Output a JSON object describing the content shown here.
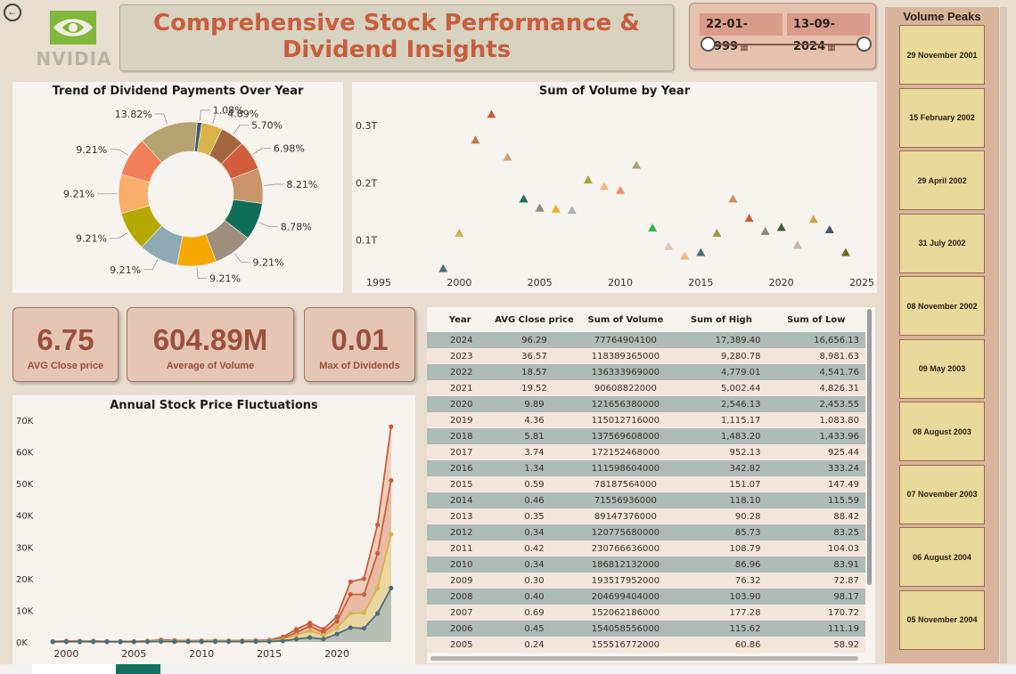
{
  "header": {
    "title_line1": "Comprehensive Stock Performance &",
    "title_line2": "Dividend Insights",
    "logo_text": "NVIDIA",
    "back_icon": "back-arrow-icon"
  },
  "date_filter": {
    "start": "22-01-1999",
    "end": "13-09-2024",
    "start_fraction": 0,
    "end_fraction": 1
  },
  "volume_peaks": {
    "title": "Volume Peaks",
    "items": [
      "29 November 2001",
      "15 February 2002",
      "29 April 2002",
      "31 July 2002",
      "08 November 2002",
      "09 May 2003",
      "08 August 2003",
      "07 November 2003",
      "06 August 2004",
      "05 November 2004"
    ]
  },
  "kpis": {
    "avg_close": {
      "value": "6.75",
      "label": "AVG Close price"
    },
    "avg_volume": {
      "value": "604.89M",
      "label": "Average of Volume"
    },
    "max_dividends": {
      "value": "0.01",
      "label": "Max of Dividends"
    }
  },
  "colors": {
    "accent": "#c95d3d",
    "background": "#e9ddd0",
    "panel": "#f7f3ee",
    "kpi": "#e5c5b4"
  },
  "table": {
    "headers": [
      "Year",
      "AVG Close price",
      "Sum of Volume",
      "Sum of High",
      "Sum of Low"
    ],
    "rows": [
      [
        "2024",
        "96.29",
        "77764904100",
        "17,389.40",
        "16,656.13"
      ],
      [
        "2023",
        "36.57",
        "118389365000",
        "9,280.78",
        "8,981.63"
      ],
      [
        "2022",
        "18.57",
        "136333969000",
        "4,779.01",
        "4,541.76"
      ],
      [
        "2021",
        "19.52",
        "90608822000",
        "5,002.44",
        "4,826.31"
      ],
      [
        "2020",
        "9.89",
        "121656380000",
        "2,546.13",
        "2,453.55"
      ],
      [
        "2019",
        "4.36",
        "115012716000",
        "1,115.17",
        "1,083.80"
      ],
      [
        "2018",
        "5.81",
        "137569608000",
        "1,483.20",
        "1,433.96"
      ],
      [
        "2017",
        "3.74",
        "172152468000",
        "952.13",
        "925.44"
      ],
      [
        "2016",
        "1.34",
        "111598604000",
        "342.82",
        "333.24"
      ],
      [
        "2015",
        "0.59",
        "78187564000",
        "151.07",
        "147.49"
      ],
      [
        "2014",
        "0.46",
        "71556936000",
        "118.10",
        "115.59"
      ],
      [
        "2013",
        "0.35",
        "89147376000",
        "90.28",
        "88.42"
      ],
      [
        "2012",
        "0.34",
        "120775680000",
        "85.73",
        "83.25"
      ],
      [
        "2011",
        "0.42",
        "230766636000",
        "108.79",
        "104.03"
      ],
      [
        "2010",
        "0.34",
        "186812132000",
        "86.96",
        "83.91"
      ],
      [
        "2009",
        "0.30",
        "193517952000",
        "76.32",
        "72.87"
      ],
      [
        "2008",
        "0.40",
        "204699404000",
        "103.90",
        "98.17"
      ],
      [
        "2007",
        "0.69",
        "152062186000",
        "177.28",
        "170.72"
      ],
      [
        "2006",
        "0.45",
        "154058556000",
        "115.62",
        "111.19"
      ],
      [
        "2005",
        "0.24",
        "155516772000",
        "60.86",
        "58.92"
      ]
    ]
  },
  "chart_data": [
    {
      "type": "pie",
      "title": "Trend of Dividend Payments Over Year",
      "donut": true,
      "labels": [
        "1.08%",
        "4.89%",
        "5.70%",
        "6.98%",
        "8.21%",
        "8.78%",
        "9.21%",
        "9.21%",
        "9.21%",
        "9.21%",
        "9.21%",
        "9.21%",
        "13.82%"
      ],
      "values": [
        1.08,
        4.89,
        5.7,
        6.98,
        8.21,
        8.78,
        9.21,
        9.21,
        9.21,
        9.21,
        9.21,
        9.21,
        13.82
      ],
      "colors": [
        "#3e5c76",
        "#d9b34a",
        "#a3663d",
        "#d45e3c",
        "#c9946a",
        "#0f6e58",
        "#9e8e7e",
        "#f5a800",
        "#8daab5",
        "#b5a800",
        "#f9ae6a",
        "#f27f5a",
        "#b7a370"
      ]
    },
    {
      "type": "scatter",
      "title": "Sum of Volume by Year",
      "xlim": [
        1995,
        2025
      ],
      "xticks": [
        "1995",
        "2000",
        "2005",
        "2010",
        "2015",
        "2020",
        "2025"
      ],
      "yticks": [
        {
          "v": 0.1,
          "label": "0.1T"
        },
        {
          "v": 0.2,
          "label": "0.2T"
        },
        {
          "v": 0.3,
          "label": "0.3T"
        }
      ],
      "ylim": [
        0.04,
        0.33
      ],
      "marker": "triangle",
      "points": [
        {
          "x": 1999,
          "y": 0.05,
          "color": "#4a6e7a"
        },
        {
          "x": 2000,
          "y": 0.112,
          "color": "#c8b45a"
        },
        {
          "x": 2001,
          "y": 0.275,
          "color": "#c07a4a"
        },
        {
          "x": 2002,
          "y": 0.32,
          "color": "#c95d3d"
        },
        {
          "x": 2003,
          "y": 0.245,
          "color": "#d4a070"
        },
        {
          "x": 2004,
          "y": 0.172,
          "color": "#1f6e5a"
        },
        {
          "x": 2005,
          "y": 0.156,
          "color": "#8f8680"
        },
        {
          "x": 2006,
          "y": 0.154,
          "color": "#f3b01e"
        },
        {
          "x": 2007,
          "y": 0.152,
          "color": "#9fb3b8"
        },
        {
          "x": 2008,
          "y": 0.205,
          "color": "#a8a23a"
        },
        {
          "x": 2009,
          "y": 0.194,
          "color": "#f3b880"
        },
        {
          "x": 2010,
          "y": 0.187,
          "color": "#ee8a6a"
        },
        {
          "x": 2011,
          "y": 0.231,
          "color": "#a8a07a"
        },
        {
          "x": 2012,
          "y": 0.121,
          "color": "#28b848"
        },
        {
          "x": 2013,
          "y": 0.089,
          "color": "#e0c8b4"
        },
        {
          "x": 2014,
          "y": 0.072,
          "color": "#f3b880"
        },
        {
          "x": 2015,
          "y": 0.078,
          "color": "#4a6e7a"
        },
        {
          "x": 2016,
          "y": 0.112,
          "color": "#9a9a38"
        },
        {
          "x": 2017,
          "y": 0.172,
          "color": "#d48a5a"
        },
        {
          "x": 2018,
          "y": 0.138,
          "color": "#c95d3d"
        },
        {
          "x": 2019,
          "y": 0.115,
          "color": "#8f8680"
        },
        {
          "x": 2020,
          "y": 0.122,
          "color": "#3e5e3a"
        },
        {
          "x": 2021,
          "y": 0.091,
          "color": "#c4b8ae"
        },
        {
          "x": 2022,
          "y": 0.136,
          "color": "#d4a040"
        },
        {
          "x": 2023,
          "y": 0.118,
          "color": "#3e5c6a"
        },
        {
          "x": 2024,
          "y": 0.078,
          "color": "#6e6a1e"
        }
      ]
    },
    {
      "type": "area",
      "title": "Annual Stock Price Fluctuations",
      "xlim": [
        1998,
        2025
      ],
      "xticks": [
        "2000",
        "2005",
        "2010",
        "2015",
        "2020"
      ],
      "ylim": [
        0,
        70000
      ],
      "yticks": [
        "0K",
        "10K",
        "20K",
        "30K",
        "40K",
        "50K",
        "60K",
        "70K"
      ],
      "x": [
        1999,
        2000,
        2001,
        2002,
        2003,
        2004,
        2005,
        2006,
        2007,
        2008,
        2009,
        2010,
        2011,
        2012,
        2013,
        2014,
        2015,
        2016,
        2017,
        2018,
        2019,
        2020,
        2021,
        2022,
        2023,
        2024
      ],
      "series": [
        {
          "color": "#c95d3d",
          "values": [
            200,
            300,
            300,
            300,
            200,
            200,
            200,
            300,
            700,
            500,
            400,
            400,
            400,
            400,
            400,
            500,
            600,
            1600,
            4000,
            6000,
            4000,
            8000,
            19000,
            20000,
            37000,
            68000
          ]
        },
        {
          "color": "#c95d3d",
          "values": [
            150,
            250,
            250,
            250,
            150,
            150,
            150,
            250,
            500,
            400,
            300,
            350,
            350,
            350,
            350,
            450,
            500,
            1200,
            3000,
            5000,
            3000,
            6500,
            15000,
            15000,
            28000,
            51000
          ]
        },
        {
          "color": "#d9b34a",
          "values": [
            100,
            150,
            150,
            150,
            100,
            100,
            100,
            150,
            350,
            250,
            200,
            250,
            250,
            250,
            250,
            300,
            350,
            800,
            2200,
            3500,
            2100,
            4500,
            9000,
            9200,
            17000,
            34000
          ]
        },
        {
          "color": "#4a6e7a",
          "values": [
            40,
            60,
            60,
            60,
            40,
            40,
            40,
            60,
            150,
            100,
            80,
            100,
            100,
            100,
            100,
            120,
            150,
            330,
            900,
            1400,
            900,
            2500,
            4500,
            4300,
            9000,
            17000
          ]
        }
      ]
    }
  ]
}
